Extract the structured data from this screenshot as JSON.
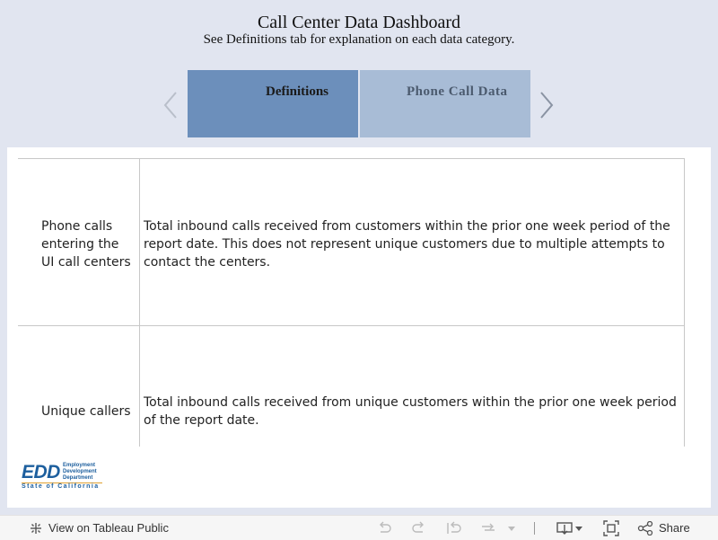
{
  "header": {
    "title": "Call Center Data Dashboard",
    "subtitle": "See Definitions tab for explanation on each data category."
  },
  "tabs": [
    {
      "label": "Definitions",
      "active": true
    },
    {
      "label": "Phone Call Data",
      "active": false
    }
  ],
  "definitions_table": {
    "rows": [
      {
        "term": "Phone calls entering the UI call centers",
        "definition": "Total inbound calls received from customers within the prior one week period of the report date. This does not represent unique customers due to multiple attempts to contact the centers."
      },
      {
        "term": "Unique callers",
        "definition": "Total inbound calls received from unique customers within the prior one week period of the report date."
      }
    ]
  },
  "logo": {
    "abbr": "EDD",
    "line1": "Employment",
    "line2": "Development",
    "line3": "Department",
    "state": "State of California"
  },
  "toolbar": {
    "view_label": "View on Tableau Public",
    "share_label": "Share"
  },
  "icons": {
    "prev": "chevron-left-icon",
    "next": "chevron-right-icon",
    "view": "tableau-logo-icon",
    "undo": "undo-icon",
    "redo": "redo-icon",
    "revert": "revert-icon",
    "refresh": "refresh-icon",
    "download": "download-icon",
    "fullscreen": "fullscreen-icon",
    "share": "share-icon"
  },
  "colors": {
    "background": "#e1e5f0",
    "tab_active": "#6c8fbb",
    "tab_inactive": "#a8bcd6",
    "logo_blue": "#1d5f9e",
    "logo_orange": "#e0a030"
  }
}
